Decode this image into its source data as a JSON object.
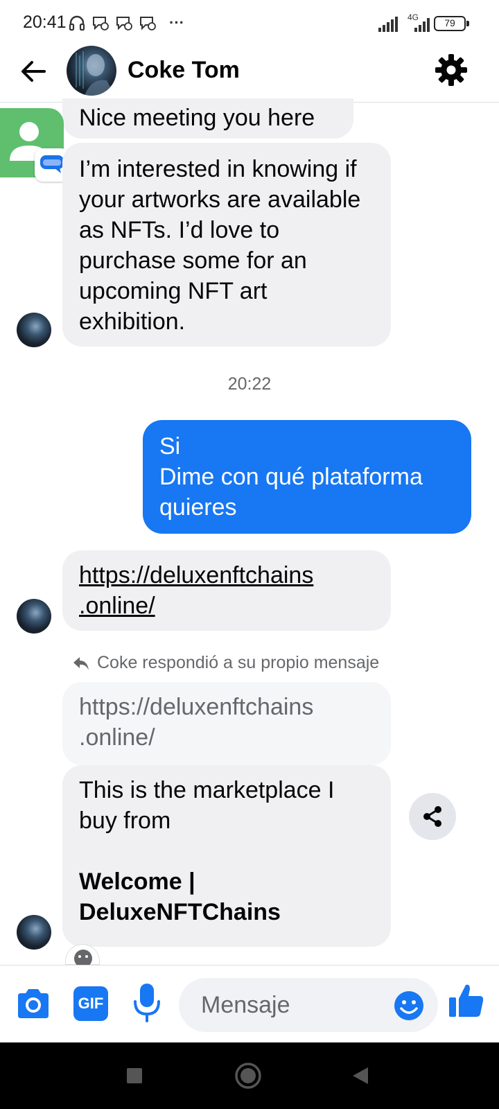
{
  "status_bar": {
    "time": "20:41",
    "more": "···",
    "network": "4G",
    "battery": "79"
  },
  "header": {
    "contact_name": "Coke Tom"
  },
  "messages": {
    "m1": "Nice meeting you here",
    "m2": "I’m interested in knowing if your artworks are available as NFTs. I’d love to purchase some for an upcoming NFT art exhibition.",
    "timestamp": "20:22",
    "out_line1": "Si",
    "out_line2": "Dime con qué plataforma quieres",
    "link_line1": "https://deluxenftchains",
    "link_line2": ".online/",
    "reply_note": "Coke respondió a su propio mensaje",
    "quoted_line1": "https://deluxenftchains",
    "quoted_line2": ".online/",
    "reply_text": "This is the marketplace I buy from",
    "reply_title_line1": "Welcome |",
    "reply_title_line2": "DeluxeNFTChains"
  },
  "composer": {
    "placeholder": "Mensaje",
    "gif_label": "GIF"
  },
  "colors": {
    "accent": "#1877f2",
    "incoming_bubble": "#f0f0f2"
  }
}
